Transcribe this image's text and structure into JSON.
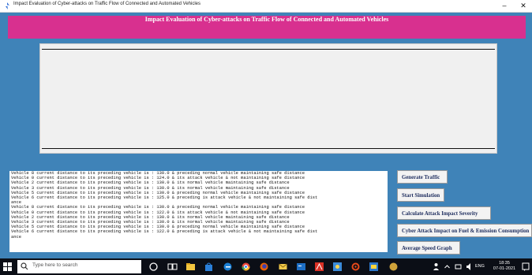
{
  "window": {
    "title": "Impact Evaluation of Cyber-attacks on Traffic Flow of Connected and Automated Vehicles",
    "minimize_glyph": "–",
    "close_glyph": "✕"
  },
  "header": {
    "title": "Impact Evaluation of Cyber-attacks on Traffic Flow of Connected and Automated Vehicles"
  },
  "log": {
    "lines": [
      "Vehicle 8 current distance to its preceding vehicle is : 130.0 & preceding normal vehicle maintaining safe distance",
      "Vehicle 0 current distance to its preceding vehicle is : 124.0 & its attack vehicle & not maintaining safe distance",
      "Vehicle 2 current distance to its preceding vehicle is : 130.0 & its normal vehicle maintaining safe distance",
      "Vehicle 3 current distance to its preceding vehicle is : 130.0 & its normal vehicle maintaining safe distance",
      "Vehicle 5 current distance to its preceding vehicle is : 130.0 & preceding normal vehicle maintaining safe distance",
      "Vehicle 6 current distance to its preceding vehicle is : 125.0 & preceding is attack vehicle & not maintaining safe dist",
      "ance",
      "Vehicle 8 current distance to its preceding vehicle is : 130.0 & preceding normal vehicle maintaining safe distance",
      "Vehicle 0 current distance to its preceding vehicle is : 122.0 & its attack vehicle & not maintaining safe distance",
      "Vehicle 2 current distance to its preceding vehicle is : 130.0 & its normal vehicle maintaining safe distance",
      "Vehicle 3 current distance to its preceding vehicle is : 130.0 & its normal vehicle maintaining safe distance",
      "Vehicle 5 current distance to its preceding vehicle is : 130.0 & preceding normal vehicle maintaining safe distance",
      "Vehicle 6 current distance to its preceding vehicle is : 122.0 & preceding is attack vehicle & not maintaining safe dist",
      "ance"
    ]
  },
  "buttons": {
    "generate_traffic": "Generate Traffic",
    "start_simulation": "Start Simulation",
    "calculate_severity": "Calculate Attack Impact Severity",
    "fuel_emission": "Cyber Attack Impact on Fuel & Emission Consumption",
    "average_speed": "Average Speed Graph"
  },
  "taskbar": {
    "search_placeholder": "Type here to search",
    "time": "18:35",
    "date": "07-01-2021",
    "lang": "ENG"
  },
  "colors": {
    "background": "#3f83b8",
    "banner": "#d8308f",
    "button_text": "#1b2a5c",
    "taskbar": "#0b0e16"
  },
  "icons": [
    "app-icon",
    "windows-start-icon",
    "search-icon",
    "cortana-icon",
    "task-view-icon",
    "file-explorer-icon",
    "store-icon",
    "edge-icon",
    "chrome-icon",
    "firefox-icon",
    "mail-icon",
    "terminal-icon",
    "acrobat-icon",
    "paint-icon",
    "settings-icon",
    "python-icon",
    "network-icon",
    "volume-icon",
    "notification-icon"
  ]
}
